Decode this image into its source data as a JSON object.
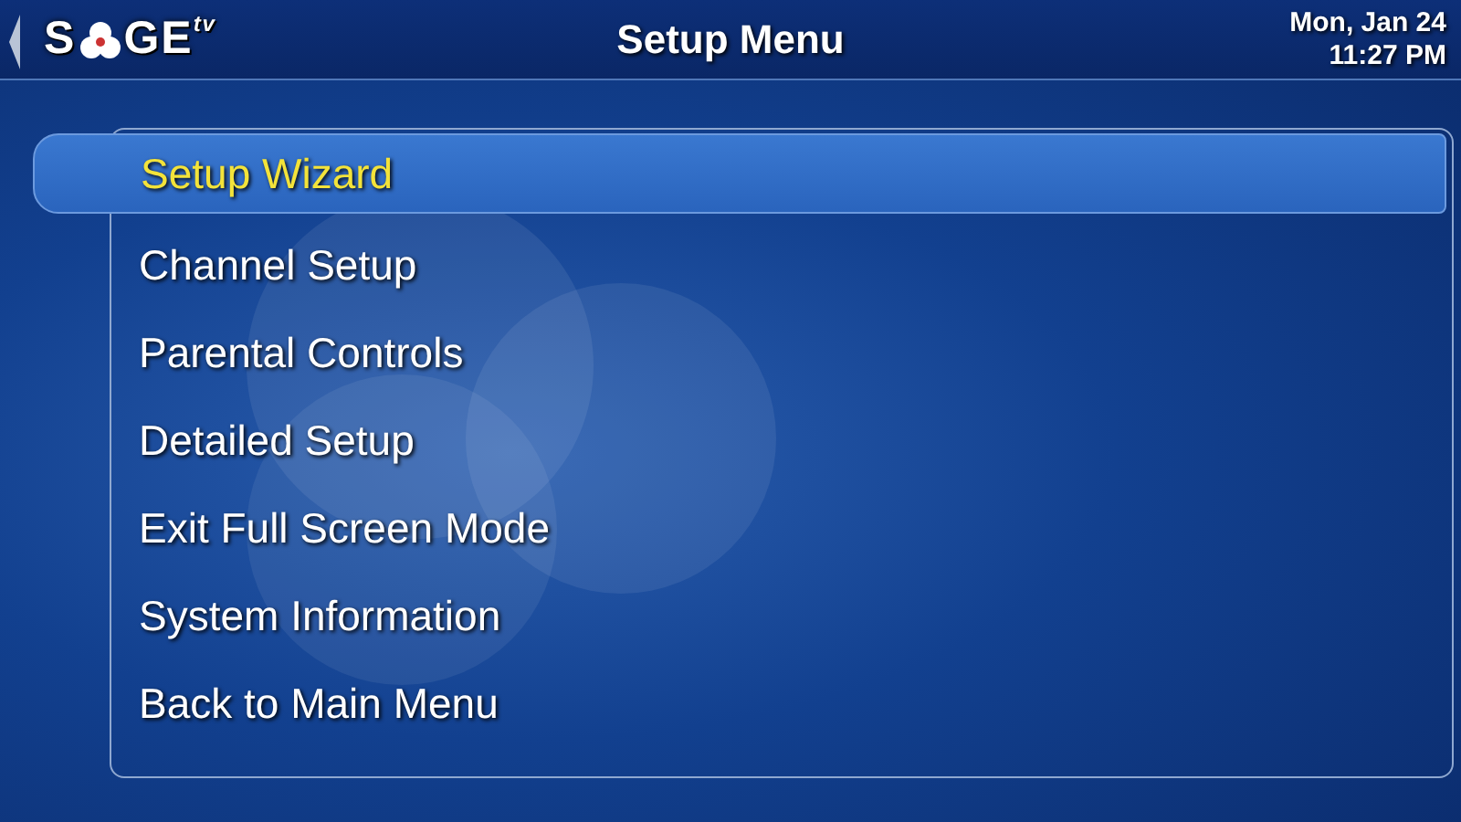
{
  "header": {
    "logo": {
      "left": "S",
      "right": "GE",
      "superscript": "tv"
    },
    "title": "Setup Menu",
    "date": "Mon, Jan 24",
    "time": "11:27 PM"
  },
  "menu": [
    {
      "label": "Setup Wizard",
      "selected": true
    },
    {
      "label": "Channel Setup",
      "selected": false
    },
    {
      "label": "Parental Controls",
      "selected": false
    },
    {
      "label": "Detailed Setup",
      "selected": false
    },
    {
      "label": "Exit Full Screen Mode",
      "selected": false
    },
    {
      "label": "System Information",
      "selected": false
    },
    {
      "label": "Back to Main Menu",
      "selected": false
    }
  ]
}
